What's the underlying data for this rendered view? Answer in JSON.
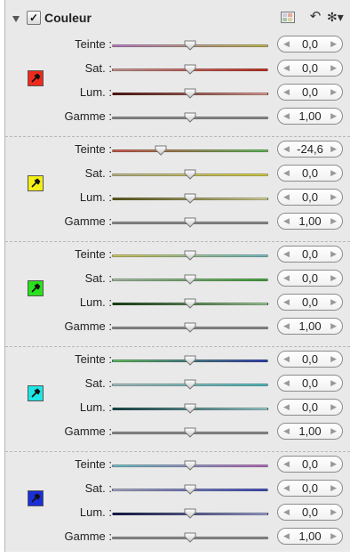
{
  "header": {
    "title": "Couleur",
    "checked": "✓",
    "icons": [
      "grid-icon",
      "undo-icon",
      "gear-icon"
    ]
  },
  "groups": [
    {
      "swatch_color": "#ee2a1c",
      "rows": [
        {
          "label": "Teinte :",
          "value": "0,0",
          "slider": 0.5,
          "colors": [
            "#c68bd4",
            "#d0c75a"
          ]
        },
        {
          "label": "Sat. :",
          "value": "0,0",
          "slider": 0.5,
          "colors": [
            "#d8a8a4",
            "#d23a2c"
          ]
        },
        {
          "label": "Lum. :",
          "value": "0,0",
          "slider": 0.5,
          "colors": [
            "#5a1a12",
            "#f0a8a0"
          ]
        },
        {
          "label": "Gamme :",
          "value": "1,00",
          "slider": 0.5,
          "colors": [
            "#9c9c9c",
            "#9c9c9c"
          ]
        }
      ]
    },
    {
      "swatch_color": "#f3ef15",
      "rows": [
        {
          "label": "Teinte :",
          "value": "-24,6",
          "slider": 0.31,
          "colors": [
            "#e0655a",
            "#6ecf68"
          ]
        },
        {
          "label": "Sat. :",
          "value": "0,0",
          "slider": 0.5,
          "colors": [
            "#c9c69a",
            "#e7e052"
          ]
        },
        {
          "label": "Lum. :",
          "value": "0,0",
          "slider": 0.5,
          "colors": [
            "#6a6522",
            "#e8e6a8"
          ]
        },
        {
          "label": "Gamme :",
          "value": "1,00",
          "slider": 0.5,
          "colors": [
            "#9c9c9c",
            "#9c9c9c"
          ]
        }
      ]
    },
    {
      "swatch_color": "#29e11c",
      "rows": [
        {
          "label": "Teinte :",
          "value": "0,0",
          "slider": 0.5,
          "colors": [
            "#e2d96a",
            "#7fd0d8"
          ]
        },
        {
          "label": "Sat. :",
          "value": "0,0",
          "slider": 0.5,
          "colors": [
            "#b9ccb6",
            "#4fb545"
          ]
        },
        {
          "label": "Lum. :",
          "value": "0,0",
          "slider": 0.5,
          "colors": [
            "#1d4a1a",
            "#a8dba2"
          ]
        },
        {
          "label": "Gamme :",
          "value": "1,00",
          "slider": 0.5,
          "colors": [
            "#9c9c9c",
            "#9c9c9c"
          ]
        }
      ]
    },
    {
      "swatch_color": "#1ee6e6",
      "rows": [
        {
          "label": "Teinte :",
          "value": "0,0",
          "slider": 0.5,
          "colors": [
            "#6fcf69",
            "#3b49bd"
          ]
        },
        {
          "label": "Sat. :",
          "value": "0,0",
          "slider": 0.5,
          "colors": [
            "#b9cfd0",
            "#5ec9cc"
          ]
        },
        {
          "label": "Lum. :",
          "value": "0,0",
          "slider": 0.5,
          "colors": [
            "#1c4e50",
            "#a9e0e2"
          ]
        },
        {
          "label": "Gamme :",
          "value": "1,00",
          "slider": 0.5,
          "colors": [
            "#9c9c9c",
            "#9c9c9c"
          ]
        }
      ]
    },
    {
      "swatch_color": "#1a2fd8",
      "rows": [
        {
          "label": "Teinte :",
          "value": "0,0",
          "slider": 0.5,
          "colors": [
            "#7fd3da",
            "#c87ad0"
          ]
        },
        {
          "label": "Sat. :",
          "value": "0,0",
          "slider": 0.5,
          "colors": [
            "#b7bbd6",
            "#4a57c8"
          ]
        },
        {
          "label": "Lum. :",
          "value": "0,0",
          "slider": 0.5,
          "colors": [
            "#141a52",
            "#a9b0e4"
          ]
        },
        {
          "label": "Gamme :",
          "value": "1,00",
          "slider": 0.5,
          "colors": [
            "#9c9c9c",
            "#9c9c9c"
          ]
        }
      ]
    }
  ]
}
